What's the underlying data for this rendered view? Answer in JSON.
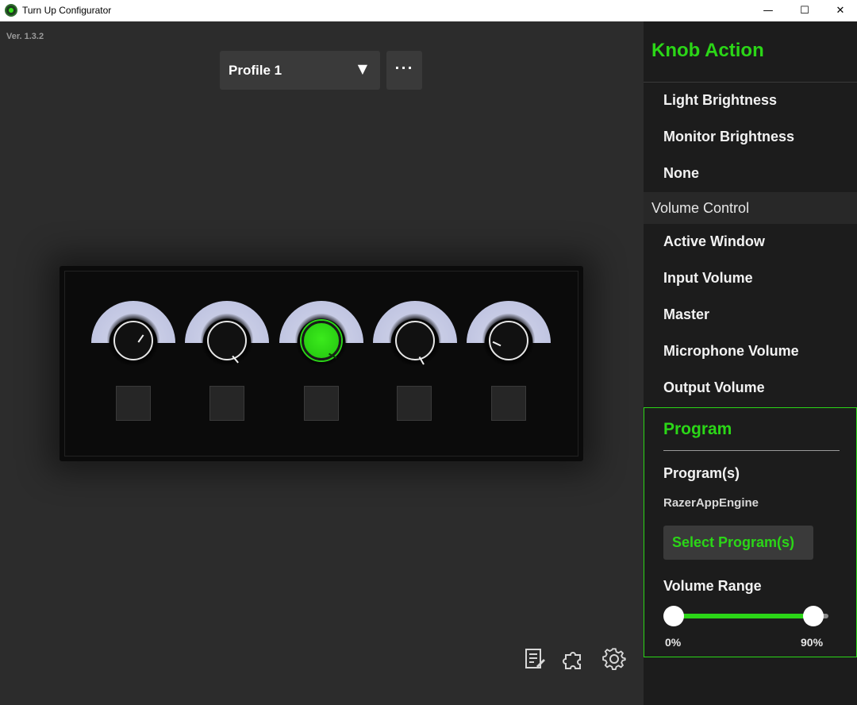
{
  "window": {
    "title": "Turn Up Configurator",
    "minimize": "—",
    "maximize": "☐",
    "close": "✕"
  },
  "main": {
    "version": "Ver. 1.3.2",
    "profile": {
      "selected": "Profile 1",
      "arrow": "▼"
    },
    "more_label": "···",
    "device": {
      "knobs": [
        {
          "active": false
        },
        {
          "active": false
        },
        {
          "active": true
        },
        {
          "active": false
        },
        {
          "active": false
        }
      ]
    },
    "bottom_icons": [
      "notes-icon",
      "puzzle-icon",
      "gear-icon"
    ]
  },
  "sidebar": {
    "title": "Knob Action",
    "items_top": [
      "Light Brightness",
      "Monitor Brightness",
      "None"
    ],
    "section": "Volume Control",
    "items_volume": [
      "Active Window",
      "Input Volume",
      "Master",
      "Microphone Volume",
      "Output Volume"
    ],
    "program": {
      "title": "Program",
      "programs_label": "Program(s)",
      "program_name": "RazerAppEngine",
      "select_button": "Select Program(s)",
      "range_label": "Volume Range",
      "range_min": "0%",
      "range_max": "90%"
    }
  },
  "colors": {
    "accent": "#2bd617",
    "background": "#2c2c2c",
    "sidebar": "#1c1c1c"
  }
}
